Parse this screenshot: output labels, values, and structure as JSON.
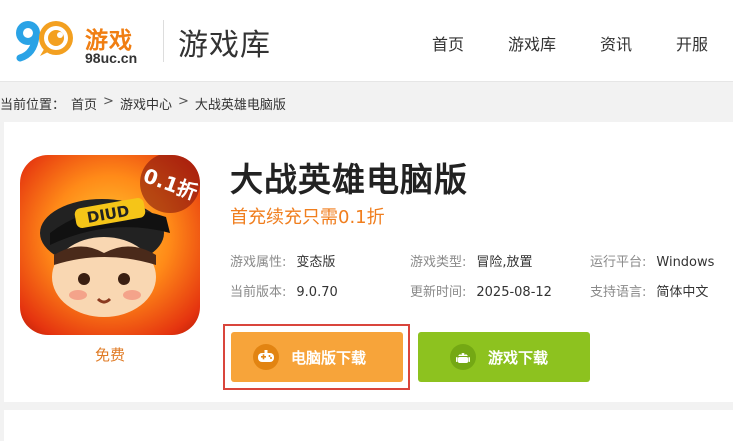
{
  "header": {
    "logo_name": "游戏",
    "logo_domain": "98uc.cn",
    "site_title": "游戏库",
    "nav": [
      "首页",
      "游戏库",
      "资讯",
      "开服"
    ]
  },
  "breadcrumb": {
    "prefix": "当前位置：",
    "items": [
      "首页",
      "游戏中心",
      "大战英雄电脑版"
    ]
  },
  "game": {
    "badge": "0.1折",
    "free_label": "免费",
    "title": "大战英雄电脑版",
    "promo": "首充续充只需0.1折",
    "meta": [
      {
        "key": "游戏属性:",
        "value": "变态版"
      },
      {
        "key": "游戏类型:",
        "value": "冒险,放置"
      },
      {
        "key": "运行平台:",
        "value": "Windows"
      },
      {
        "key": "当前版本:",
        "value": "9.0.70"
      },
      {
        "key": "更新时间:",
        "value": "2025-08-12"
      },
      {
        "key": "支持语言:",
        "value": "简体中文"
      }
    ],
    "buttons": {
      "pc_download": "电脑版下载",
      "game_download": "游戏下载"
    }
  },
  "colors": {
    "brand_orange": "#f07e12",
    "pc_button": "#f7a43a",
    "game_button": "#8dc21f",
    "highlight_border": "#d9453c"
  }
}
